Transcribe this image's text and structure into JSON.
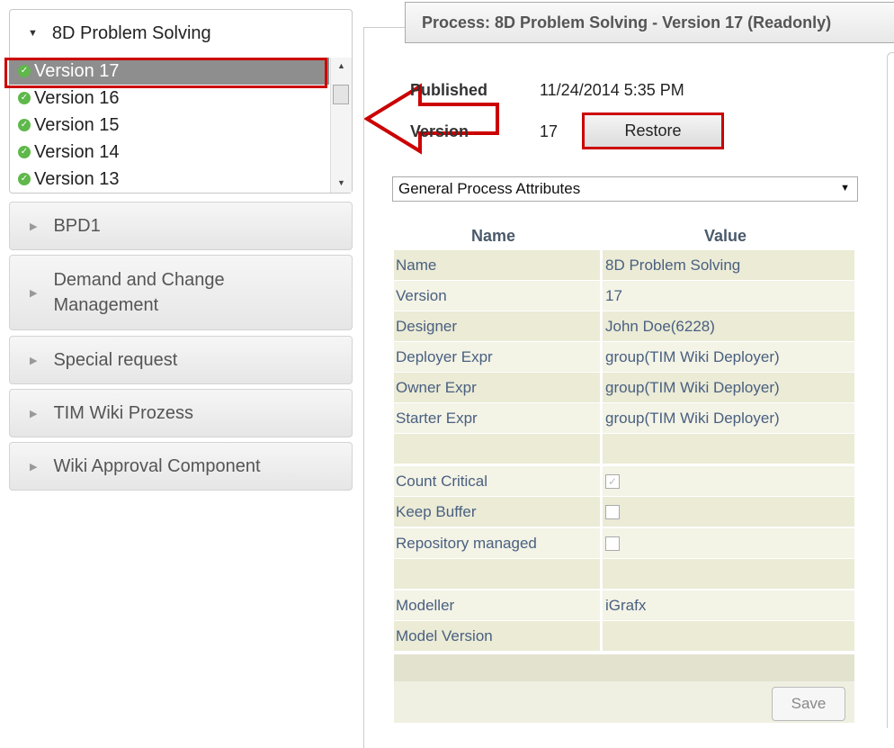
{
  "sidebar": {
    "open_process": "8D Problem Solving",
    "versions": [
      {
        "label": "Version 17",
        "selected": true
      },
      {
        "label": "Version 16",
        "selected": false
      },
      {
        "label": "Version 15",
        "selected": false
      },
      {
        "label": "Version 14",
        "selected": false
      },
      {
        "label": "Version 13",
        "selected": false
      }
    ],
    "processes": [
      "BPD1",
      "Demand and Change Management",
      "Special request",
      "TIM Wiki Prozess",
      "Wiki Approval Component"
    ]
  },
  "panel": {
    "title": "Process: 8D Problem Solving - Version 17 (Readonly)",
    "published_label": "Published",
    "published_value": "11/24/2014 5:35 PM",
    "version_label": "Version",
    "version_value": "17",
    "restore_label": "Restore",
    "attribute_group": "General Process Attributes",
    "col_name": "Name",
    "col_value": "Value",
    "rows": [
      {
        "name": "Name",
        "value": "8D Problem Solving"
      },
      {
        "name": "Version",
        "value": "17"
      },
      {
        "name": "Designer",
        "value": "John Doe(6228)"
      },
      {
        "name": "Deployer Expr",
        "value": "group(TIM Wiki Deployer)"
      },
      {
        "name": "Owner Expr",
        "value": "group(TIM Wiki Deployer)"
      },
      {
        "name": "Starter Expr",
        "value": "group(TIM Wiki Deployer)"
      },
      {
        "name": "",
        "value": ""
      },
      {
        "name": "Count Critical",
        "checkbox": true,
        "checked": true
      },
      {
        "name": "Keep Buffer",
        "checkbox": true,
        "checked": false
      },
      {
        "name": "Repository managed",
        "checkbox": true,
        "checked": false
      },
      {
        "name": "",
        "value": ""
      },
      {
        "name": "Modeller",
        "value": "iGrafx"
      },
      {
        "name": "Model Version",
        "value": ""
      }
    ],
    "save_label": "Save"
  },
  "colors": {
    "highlight": "#cc0000",
    "selected_row": "#8e8e8e",
    "status_ok": "#5fb84a",
    "table_row": "#ebebd6"
  },
  "icons": [
    "check-circle-icon",
    "triangle-down-icon",
    "triangle-right-icon",
    "left-arrow-icon"
  ]
}
